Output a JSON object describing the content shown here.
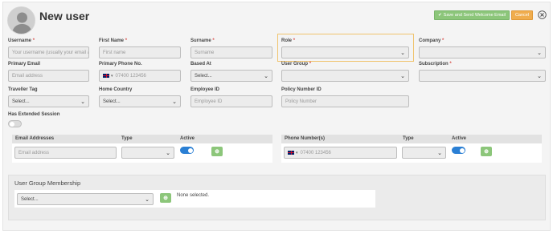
{
  "page": {
    "title": "New user",
    "save_label": "Save and Send Welcome Email",
    "cancel_label": "Cancel"
  },
  "fields": {
    "username": {
      "label": "Username",
      "placeholder": "Your username (usually your email ad"
    },
    "first_name": {
      "label": "First Name",
      "placeholder": "First name"
    },
    "surname": {
      "label": "Surname",
      "placeholder": "Surname"
    },
    "role": {
      "label": "Role",
      "value": ""
    },
    "company": {
      "label": "Company",
      "value": ""
    },
    "primary_email": {
      "label": "Primary Email",
      "placeholder": "Email address"
    },
    "primary_phone": {
      "label": "Primary Phone No.",
      "placeholder": "07400 123456",
      "country": "GB"
    },
    "based_at": {
      "label": "Based At",
      "value": "Select..."
    },
    "user_group": {
      "label": "User Group",
      "value": ""
    },
    "subscription": {
      "label": "Subscription",
      "value": ""
    },
    "traveller_tag": {
      "label": "Traveller Tag",
      "value": "Select..."
    },
    "home_country": {
      "label": "Home Country",
      "value": "Select..."
    },
    "employee_id": {
      "label": "Employee ID",
      "placeholder": "Employee ID"
    },
    "policy_number": {
      "label": "Policy Number ID",
      "placeholder": "Policy Number"
    },
    "extended_session": {
      "label": "Has Extended Session",
      "enabled": false
    }
  },
  "emails_panel": {
    "headers": [
      "Email Addresses",
      "Type",
      "Active"
    ],
    "row": {
      "placeholder": "Email address",
      "type_value": "",
      "active": true
    }
  },
  "phones_panel": {
    "headers": [
      "Phone Number(s)",
      "Type",
      "Active"
    ],
    "row": {
      "placeholder": "07400 123456",
      "country": "GB",
      "type_value": "",
      "active": true
    }
  },
  "user_group_membership": {
    "title": "User Group Membership",
    "select_value": "Select...",
    "selected_text": "None selected."
  },
  "required_marker": "*",
  "colors": {
    "save": "#8cc67a",
    "cancel": "#f0ad4e",
    "toggle_on": "#2a7fd4",
    "required": "#d9534f",
    "highlight": "#f0c36d"
  }
}
